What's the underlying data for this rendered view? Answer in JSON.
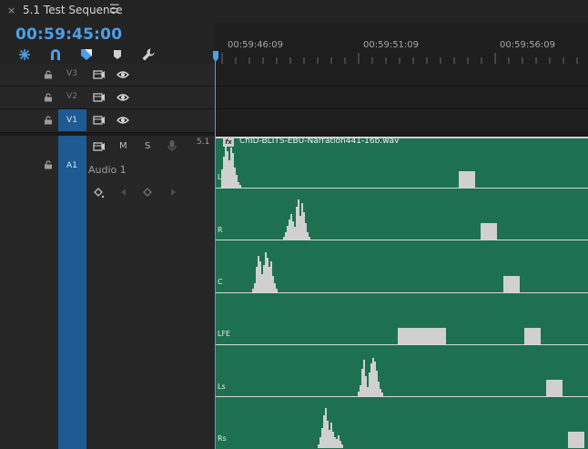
{
  "panel": {
    "close_glyph": "×",
    "title": "5.1 Test Sequence",
    "menu_glyph": "☰"
  },
  "timecode": "00:59:45:00",
  "toolbar": {
    "icons": [
      "snap-icon",
      "linked-selection-icon",
      "add-marker-icon",
      "marker-icon",
      "wrench-icon"
    ]
  },
  "ruler": {
    "labels": [
      "00:59:46:09",
      "00:59:51:09",
      "00:59:56:09"
    ]
  },
  "tracks": {
    "video": [
      {
        "id": "V3",
        "targeted": false
      },
      {
        "id": "V2",
        "targeted": false
      },
      {
        "id": "V1",
        "targeted": true
      }
    ],
    "audio": {
      "id": "A1",
      "name": "Audio 1",
      "mute_label": "M",
      "solo_label": "S",
      "channel_badge": "5.1"
    }
  },
  "clip": {
    "fx_label": "fx",
    "name": "ChID-BLITS-EBU-Narration441-16b.wav",
    "channels": [
      "L",
      "R",
      "C",
      "LFE",
      "Ls",
      "Rs"
    ]
  },
  "colors": {
    "accent": "#4c9fe8",
    "clip_green": "#1d7150",
    "track_target_blue": "#1f5a93"
  }
}
